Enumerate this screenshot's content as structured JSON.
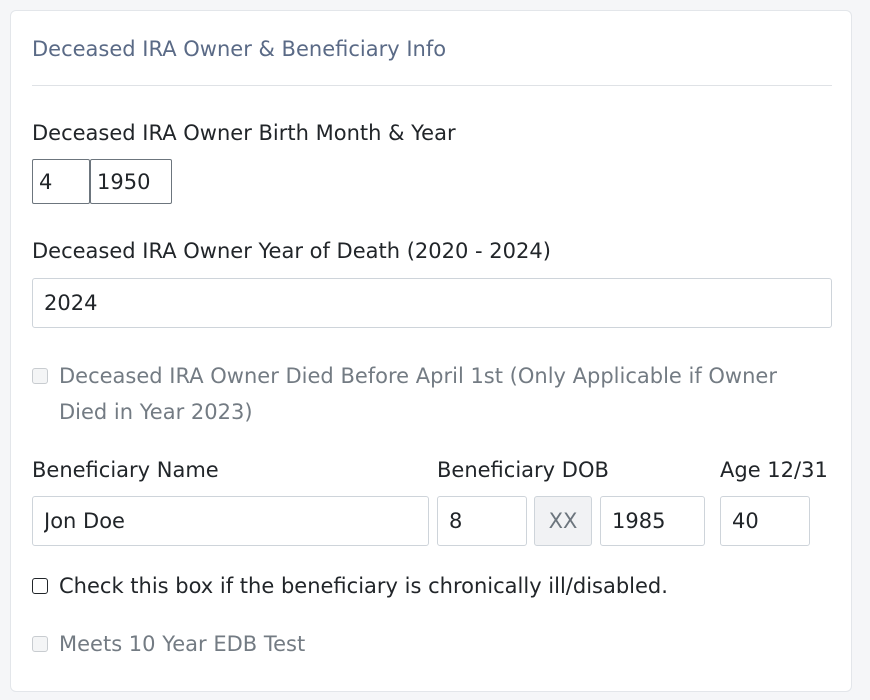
{
  "section": {
    "title": "Deceased IRA Owner & Beneficiary Info"
  },
  "owner_birth": {
    "label": "Deceased IRA Owner Birth Month & Year",
    "month": "4",
    "year": "1950"
  },
  "owner_death": {
    "label": "Deceased IRA Owner Year of Death (2020 - 2024)",
    "year": "2024"
  },
  "died_before_april": {
    "label_line1": "Deceased IRA Owner Died Before April 1st (Only Applicable if Owner",
    "label_line2": "Died in Year 2023)",
    "checked": false,
    "disabled": true
  },
  "beneficiary": {
    "name_label": "Beneficiary Name",
    "name": "Jon Doe",
    "dob_label": "Beneficiary DOB",
    "dob_month": "8",
    "dob_day": "XX",
    "dob_year": "1985",
    "age_label": "Age 12/31",
    "age": "40"
  },
  "chronically_ill": {
    "label": "Check this box if the beneficiary is chronically ill/disabled.",
    "checked": false
  },
  "edb_test": {
    "label": "Meets 10 Year EDB Test",
    "checked": false,
    "disabled": true
  }
}
